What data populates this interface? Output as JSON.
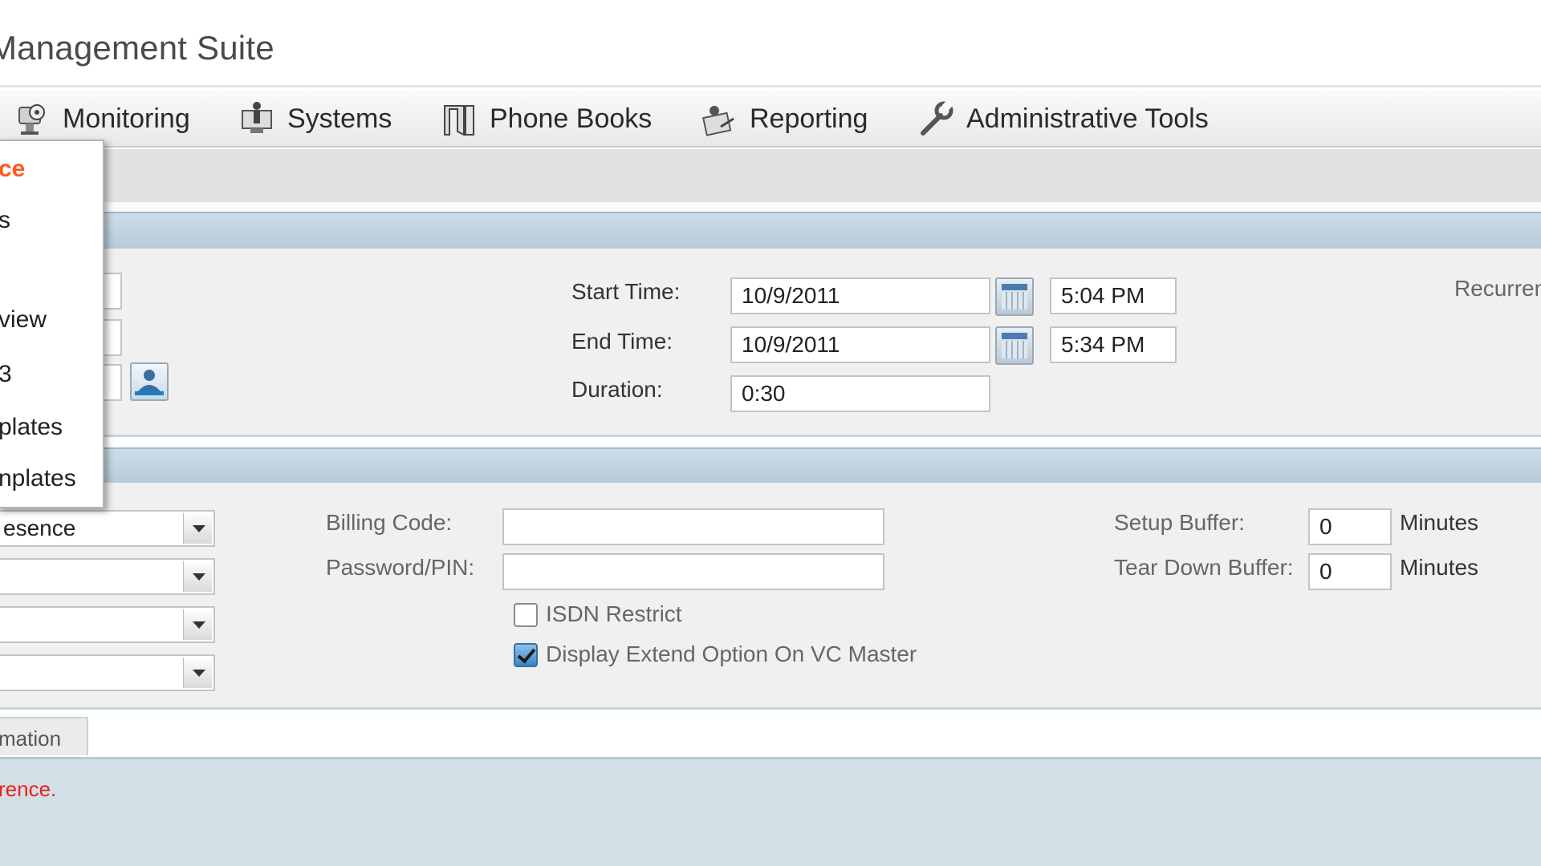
{
  "app": {
    "title": "Management Suite"
  },
  "nav": {
    "items": [
      {
        "label": "Monitoring",
        "icon": "monitoring-icon"
      },
      {
        "label": "Systems",
        "icon": "systems-icon"
      },
      {
        "label": "Phone Books",
        "icon": "phone-books-icon"
      },
      {
        "label": "Reporting",
        "icon": "reporting-icon"
      },
      {
        "label": "Administrative Tools",
        "icon": "wrench-icon"
      }
    ]
  },
  "menu": {
    "items": [
      "ce",
      "s",
      "view",
      "3",
      "plates",
      "nplates"
    ]
  },
  "time": {
    "start_label": "Start Time:",
    "start_date": "10/9/2011",
    "start_time": "5:04 PM",
    "end_label": "End Time:",
    "end_date": "10/9/2011",
    "end_time": "5:34 PM",
    "duration_label": "Duration:",
    "duration": "0:30",
    "recurrence_label": "Recurren"
  },
  "settings": {
    "select_1_value": "esence",
    "billing_label": "Billing Code:",
    "billing_value": "",
    "password_label": "Password/PIN:",
    "password_value": "",
    "isdn_label": "ISDN Restrict",
    "isdn_checked": false,
    "extend_label": "Display Extend Option On VC Master",
    "extend_checked": true,
    "setup_label": "Setup Buffer:",
    "setup_value": "0",
    "setup_unit": "Minutes",
    "teardown_label": "Tear Down Buffer:",
    "teardown_value": "0",
    "teardown_unit": "Minutes"
  },
  "bottom": {
    "tab_label": "mation",
    "message": "rence."
  },
  "colors": {
    "menu_active": "#ff5a1a",
    "error": "#e8231a",
    "section_header": "#bfd1dd"
  }
}
